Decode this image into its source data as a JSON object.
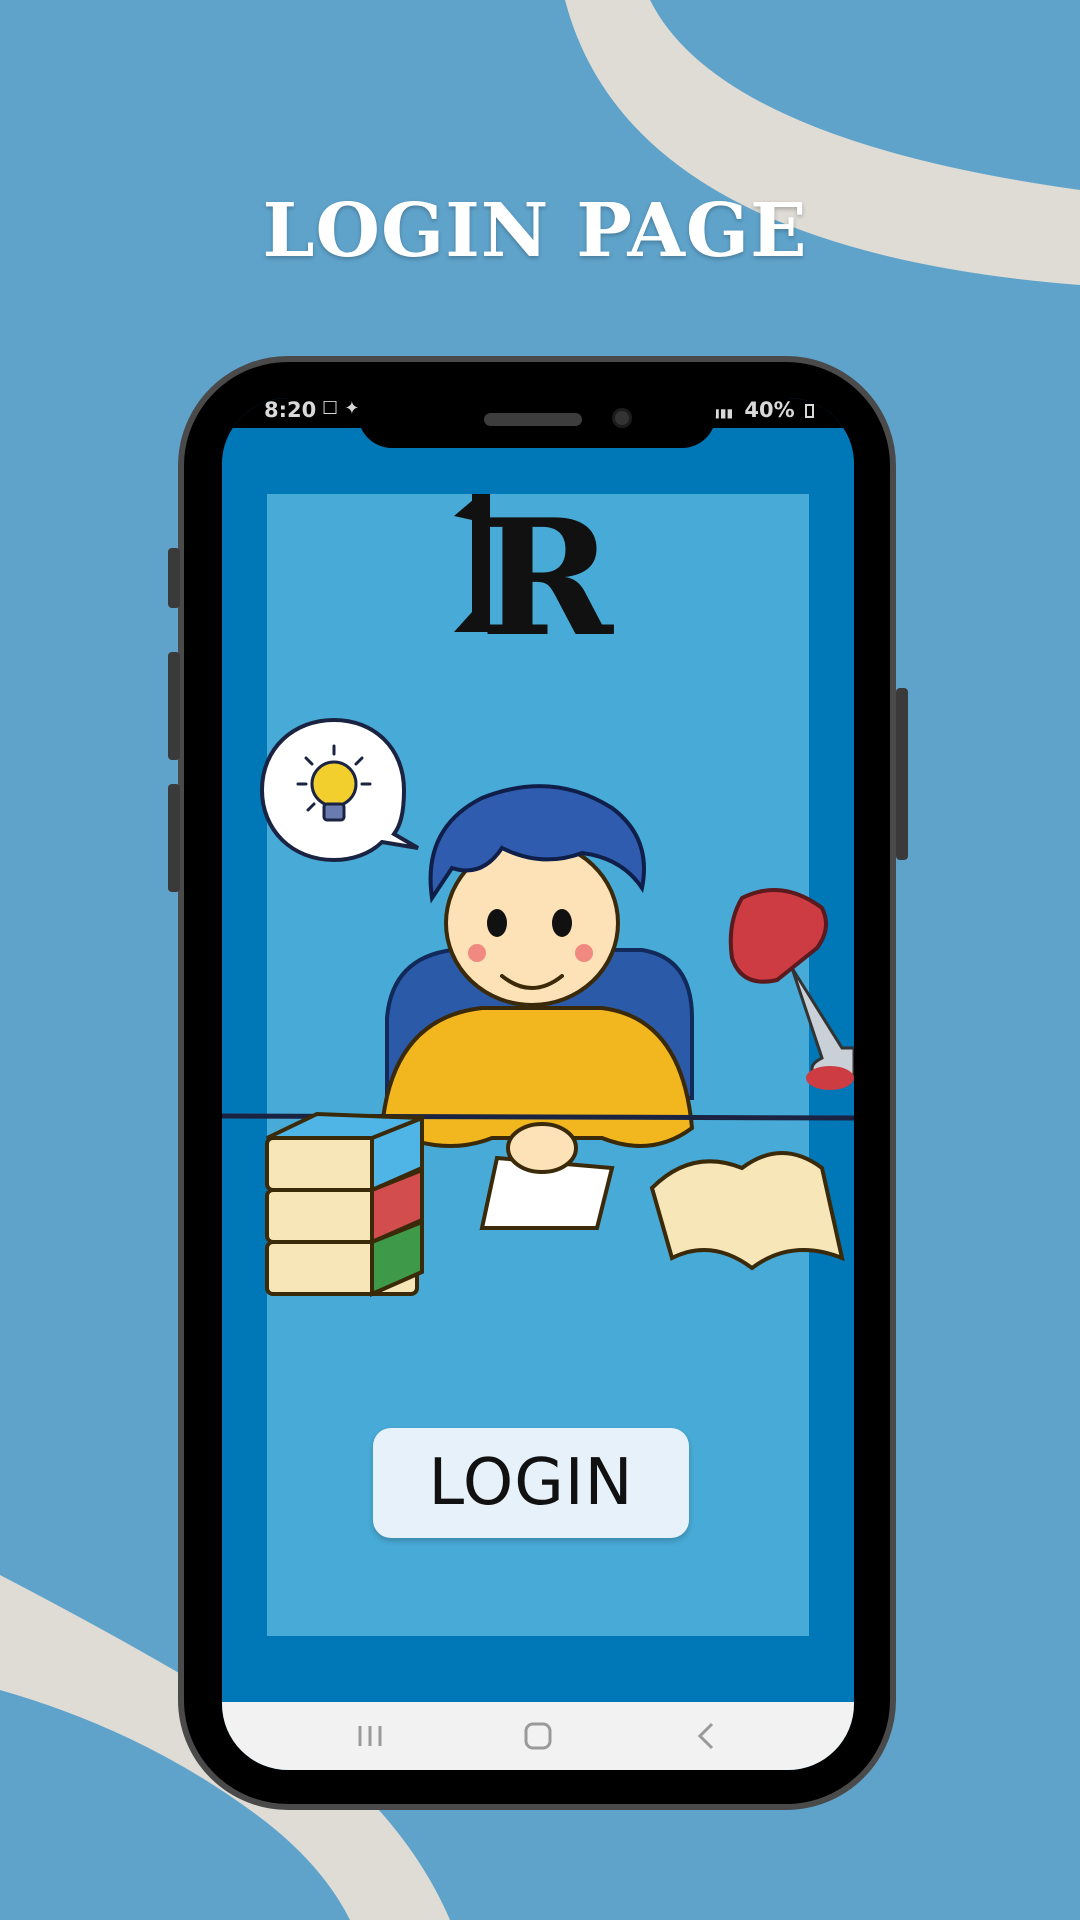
{
  "page": {
    "title": "LOGIN PAGE",
    "background_color": "#5fa3cb",
    "swoosh_color": "#dedcd5"
  },
  "status_bar": {
    "time": "8:20",
    "time_icons": "☐ ✦",
    "battery": "40%",
    "signal_icons": "▮▮▮"
  },
  "app": {
    "logo_text": "R",
    "login_label": "LOGIN",
    "primary_color": "#0077b7",
    "panel_color": "#48aad6",
    "button_color": "#e7f1f9"
  },
  "nav_bar": {
    "recents_icon": "recents-icon",
    "home_icon": "home-icon",
    "back_icon": "back-icon"
  }
}
